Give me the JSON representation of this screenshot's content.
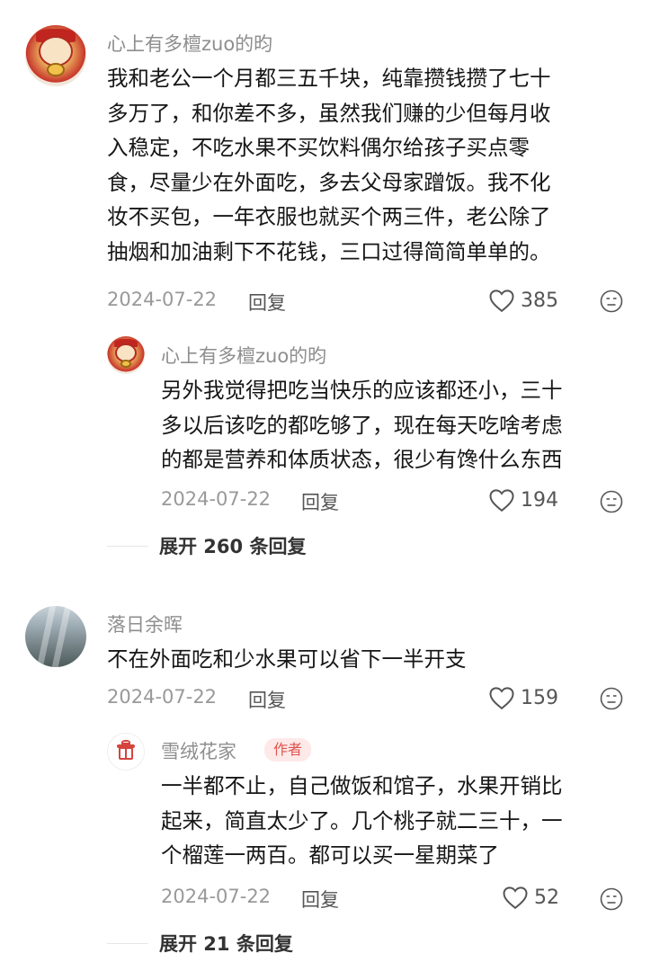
{
  "comments": [
    {
      "username": "心上有多檀zuo的昀",
      "lines": [
        "我和老公一个月都三五千块，纯靠攒钱攒了七十",
        "多万了，和你差不多，虽然我们赚的少但每月收",
        "入稳定，不吃水果不买饮料偶尔给孩子买点零",
        "食，尽量少在外面吃，多去父母家蹭饭。我不化",
        "妆不买包，一年衣服也就买个两三件，老公除了",
        "抽烟和加油剩下不花钱，三口过得简简单单的。"
      ],
      "date": "2024-07-22",
      "reply_label": "回复",
      "likes": "385",
      "replies": [
        {
          "username": "心上有多檀zuo的昀",
          "lines": [
            "另外我觉得把吃当快乐的应该都还小，三十",
            "多以后该吃的都吃够了，现在每天吃啥考虑",
            "的都是营养和体质状态，很少有馋什么东西"
          ],
          "date": "2024-07-22",
          "reply_label": "回复",
          "likes": "194"
        }
      ],
      "expand_label": "展开 260 条回复"
    },
    {
      "username": "落日余晖",
      "lines": [
        "不在外面吃和少水果可以省下一半开支"
      ],
      "date": "2024-07-22",
      "reply_label": "回复",
      "likes": "159",
      "replies": [
        {
          "username": "雪绒花家",
          "badge": "作者",
          "lines": [
            "一半都不止，自己做饭和馆子，水果开销比",
            "起来，简直太少了。几个桃子就二三十，一",
            "个榴莲一两百。都可以买一星期菜了"
          ],
          "date": "2024-07-22",
          "reply_label": "回复",
          "likes": "52"
        }
      ],
      "expand_label": "展开 21 条回复"
    }
  ],
  "icons": {
    "like": "heart-outline-icon",
    "dislike": "meh-face-icon"
  }
}
